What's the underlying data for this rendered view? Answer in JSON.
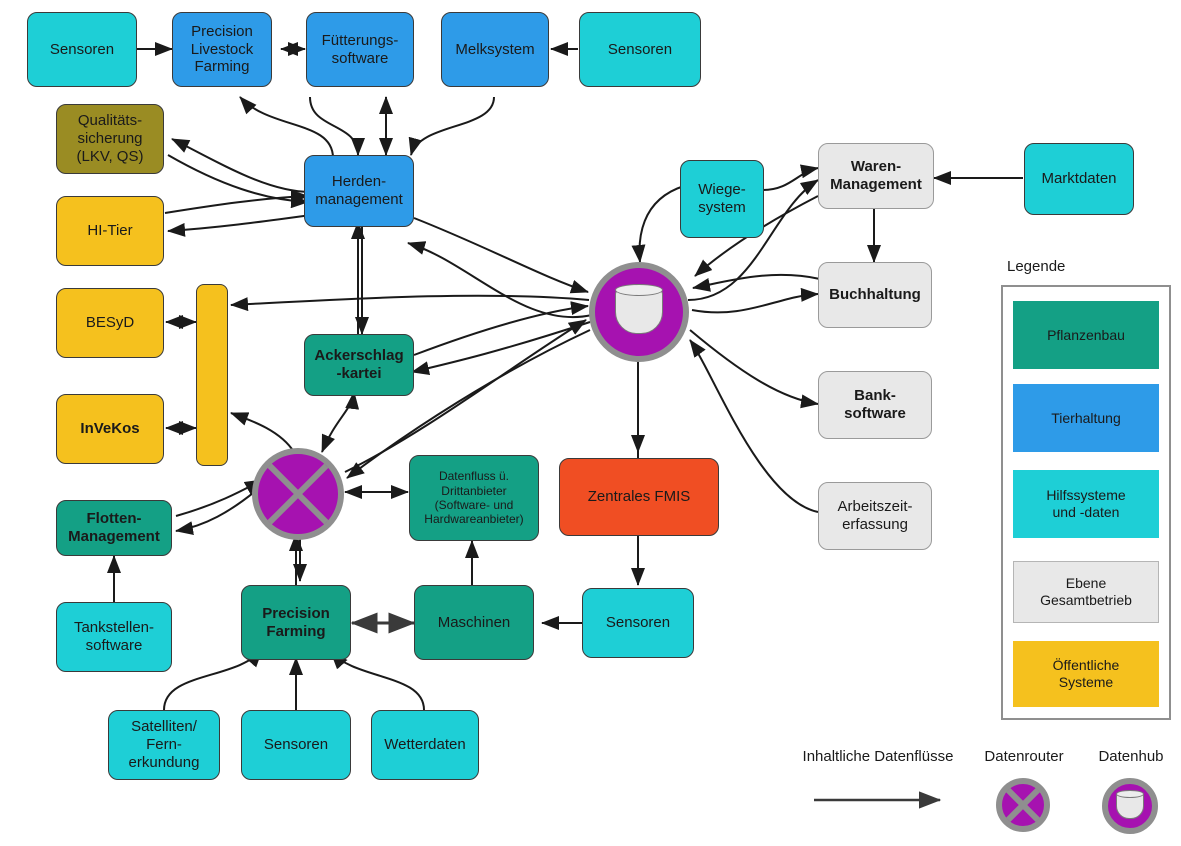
{
  "diagram": {
    "title_present": false,
    "colors": {
      "cyan": "#1ECFD6",
      "blue": "#2E9BE8",
      "green": "#14A085",
      "yellow": "#F5C11E",
      "olive": "#9A8C23",
      "grey": "#E8E8E8",
      "red": "#F04E23",
      "purple": "#A612B0",
      "circle_border": "#8F8F8F",
      "edge": "#1A1A1A"
    },
    "nodes": [
      {
        "id": "sensoren_tl",
        "label": "Sensoren",
        "color": "cyan",
        "bold": false
      },
      {
        "id": "plf",
        "label": "Precision\nLivestock\nFarming",
        "color": "blue",
        "bold": false
      },
      {
        "id": "fuetterung",
        "label": "Fütterungs-\nsoftware",
        "color": "blue",
        "bold": false
      },
      {
        "id": "melksystem",
        "label": "Melksystem",
        "color": "blue",
        "bold": false
      },
      {
        "id": "sensoren_t2",
        "label": "Sensoren",
        "color": "cyan",
        "bold": false
      },
      {
        "id": "qs",
        "label": "Qualitäts-\nsicherung\n(LKV, QS)",
        "color": "olive",
        "bold": false
      },
      {
        "id": "hitier",
        "label": "HI-Tier",
        "color": "yellow",
        "bold": false
      },
      {
        "id": "besyd",
        "label": "BESyD",
        "color": "yellow",
        "bold": false
      },
      {
        "id": "invekos",
        "label": "InVeKos",
        "color": "yellow",
        "bold": true
      },
      {
        "id": "yellowbar",
        "label": "",
        "color": "yellow",
        "bold": false
      },
      {
        "id": "herden",
        "label": "Herden-\nmanagement",
        "color": "blue",
        "bold": false
      },
      {
        "id": "ackerschlag",
        "label": "Ackerschlag\n-kartei",
        "color": "green",
        "bold": true
      },
      {
        "id": "flotten",
        "label": "Flotten-\nManagement",
        "color": "green",
        "bold": true
      },
      {
        "id": "tankstelle",
        "label": "Tankstellen-\nsoftware",
        "color": "cyan",
        "bold": false
      },
      {
        "id": "precfarming",
        "label": "Precision\nFarming",
        "color": "green",
        "bold": true
      },
      {
        "id": "satelliten",
        "label": "Satelliten/\nFern-\nerkundung",
        "color": "cyan",
        "bold": false
      },
      {
        "id": "sensoren_b1",
        "label": "Sensoren",
        "color": "cyan",
        "bold": false
      },
      {
        "id": "wetterdaten",
        "label": "Wetterdaten",
        "color": "cyan",
        "bold": false
      },
      {
        "id": "maschinen",
        "label": "Maschinen",
        "color": "green",
        "bold": false
      },
      {
        "id": "sensoren_b2",
        "label": "Sensoren",
        "color": "cyan",
        "bold": false
      },
      {
        "id": "drittanbieter",
        "label": "Datenfluss ü.\nDrittanbieter\n(Software- und\nHardwareanbieter)",
        "color": "green",
        "bold": false
      },
      {
        "id": "fmis",
        "label": "Zentrales FMIS",
        "color": "red",
        "bold": false
      },
      {
        "id": "wiege",
        "label": "Wiege-\nsystem",
        "color": "cyan",
        "bold": false
      },
      {
        "id": "waren",
        "label": "Waren-\nManagement",
        "color": "grey",
        "bold": true
      },
      {
        "id": "marktdaten",
        "label": "Marktdaten",
        "color": "cyan",
        "bold": false
      },
      {
        "id": "buchhaltung",
        "label": "Buchhaltung",
        "color": "grey",
        "bold": true
      },
      {
        "id": "banksoftware",
        "label": "Bank-\nsoftware",
        "color": "grey",
        "bold": true
      },
      {
        "id": "arbeitszeit",
        "label": "Arbeitszeit-\nerfassung",
        "color": "grey",
        "bold": false
      }
    ],
    "routers": [
      {
        "id": "datenrouter",
        "type": "router",
        "name": "Datenrouter"
      },
      {
        "id": "datenhub",
        "type": "hub",
        "name": "Datenhub"
      }
    ],
    "legend": {
      "title": "Legende",
      "items": [
        {
          "label": "Pflanzenbau",
          "color": "green"
        },
        {
          "label": "Tierhaltung",
          "color": "blue"
        },
        {
          "label": "Hilfssysteme\nund -daten",
          "color": "cyan"
        },
        {
          "label": "Ebene\nGesamtbetrieb",
          "color": "grey"
        },
        {
          "label": "Öffentliche\nSysteme",
          "color": "yellow"
        }
      ]
    },
    "footer": {
      "flow_label": "Inhaltliche Datenflüsse",
      "router_label": "Datenrouter",
      "hub_label": "Datenhub"
    }
  }
}
